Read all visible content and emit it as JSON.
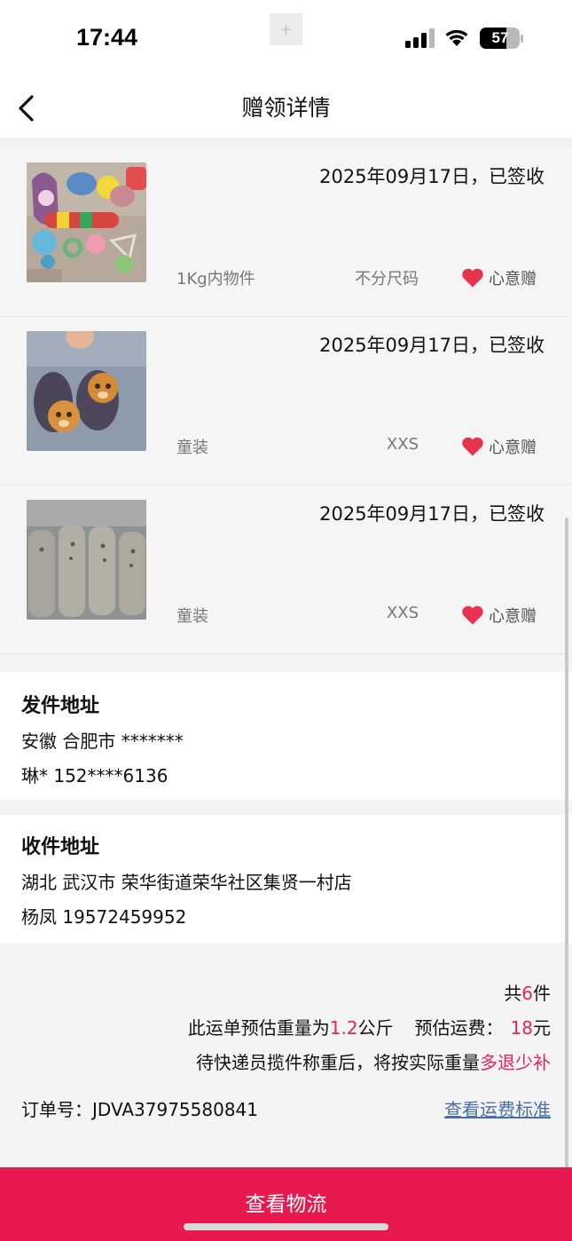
{
  "status_bar": {
    "time": "17:44",
    "battery": "57",
    "plus_glyph": "+",
    "icons": [
      "signal-icon",
      "wifi-icon",
      "battery-icon"
    ]
  },
  "nav": {
    "title": "赠领详情",
    "back_icon": "chevron-left-icon"
  },
  "items": [
    {
      "date": "2025年09月17日，已签收",
      "category": "1Kg内物件",
      "size": "不分尺码",
      "tag": "心意赠",
      "thumb": "baby-toys-photo"
    },
    {
      "date": "2025年09月17日，已签收",
      "category": "童装",
      "size": "XXS",
      "tag": "心意赠",
      "thumb": "monkey-baby-shoes-photo"
    },
    {
      "date": "2025年09月17日，已签收",
      "category": "童装",
      "size": "XXS",
      "tag": "心意赠",
      "thumb": "grey-baby-socks-photo"
    }
  ],
  "sender": {
    "heading": "发件地址",
    "region": "安徽 合肥市 *******",
    "contact": "琳* 152****6136"
  },
  "receiver": {
    "heading": "收件地址",
    "region": "湖北 武汉市 荣华街道荣华社区集贤一村店",
    "contact": "杨凤 19572459952"
  },
  "summary": {
    "count_prefix": "共",
    "count": "6",
    "count_suffix": "件",
    "weight_prefix": "此运单预估重量为",
    "weight": "1.2",
    "weight_suffix": "公斤",
    "fee_label": "预估运费：",
    "fee": "18",
    "fee_suffix": "元",
    "note_prefix": "待快递员揽件称重后，将按实际重量",
    "note_highlight": "多退少补",
    "order_label": "订单号：",
    "order_number": "JDVA37975580841",
    "fee_standard_link": "查看运费标准"
  },
  "bottom_button": {
    "label": "查看物流"
  },
  "colors": {
    "accent": "#e8194e",
    "highlight": "#e0245e",
    "link": "#4a6fa5",
    "heart": "#e8334f"
  }
}
